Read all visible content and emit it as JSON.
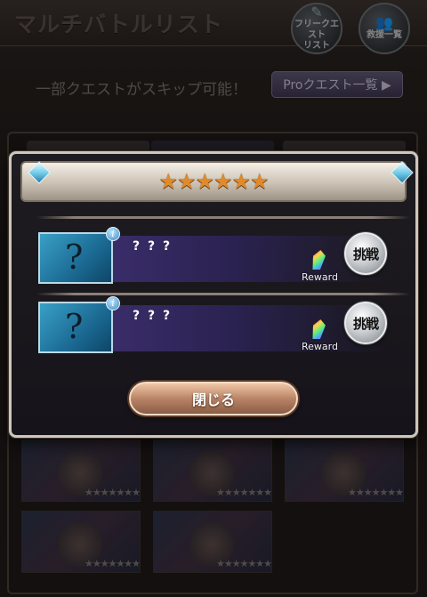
{
  "background": {
    "title": "マルチバトルリスト",
    "free_quest_label": "フリークエスト\nリスト",
    "rescue_label": "救援一覧",
    "skip_notice": "一部クエストがスキップ可能！",
    "pro_button_label": "Proクエスト一覧 ▶",
    "thumbnails": [
      {
        "stars": "★★★★★★★"
      },
      {
        "stars": "★★★★★★★"
      },
      {
        "stars": "★★★★★★★"
      },
      {
        "stars": "★★★★★★★★"
      },
      {
        "stars": "★★★★★★★★★"
      }
    ]
  },
  "modal": {
    "rank_stars": "★★★★★★",
    "quests": [
      {
        "name": "? ? ?",
        "info_icon": "i",
        "reward_label": "Reward",
        "challenge_label": "挑戦",
        "thumb_glyph": "?"
      },
      {
        "name": "? ? ?",
        "info_icon": "i",
        "reward_label": "Reward",
        "challenge_label": "挑戦",
        "thumb_glyph": "?"
      }
    ],
    "close_label": "閉じる"
  },
  "colors": {
    "modal_border": "#cfc6bb",
    "star_orange": "#e08a2c",
    "quest_strip": "#3a2d6a",
    "close_button": "#b98466"
  }
}
